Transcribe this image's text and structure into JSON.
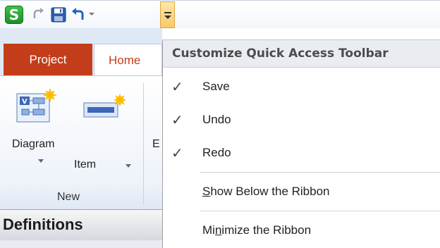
{
  "quick_access": {
    "app_logo_letter": "S",
    "icons": [
      "app-logo-icon",
      "redo-icon",
      "save-icon",
      "undo-icon",
      "chevron-down-icon",
      "customize-toolbar-icon"
    ]
  },
  "tabs": {
    "project_label": "Project",
    "home_label": "Home"
  },
  "ribbon": {
    "diagram_label": "Diagram",
    "item_label": "Item",
    "truncated_label": "E",
    "group_label": "New"
  },
  "panel": {
    "definitions_title": "Definitions"
  },
  "menu": {
    "title": "Customize Quick Access Toolbar",
    "check_glyph": "✓",
    "items": [
      {
        "label": "Save",
        "checked": true
      },
      {
        "label": "Undo",
        "checked": true
      },
      {
        "label": "Redo",
        "checked": true
      }
    ],
    "show_below": {
      "underline": "S",
      "rest": "how Below the Ribbon"
    },
    "minimize": {
      "before": "Mi",
      "underline": "n",
      "after": "imize the Ribbon"
    }
  },
  "colors": {
    "accent_red": "#c43d1b",
    "highlight": "#f7c96b",
    "ribbon_blue": "#dfe8f5"
  }
}
